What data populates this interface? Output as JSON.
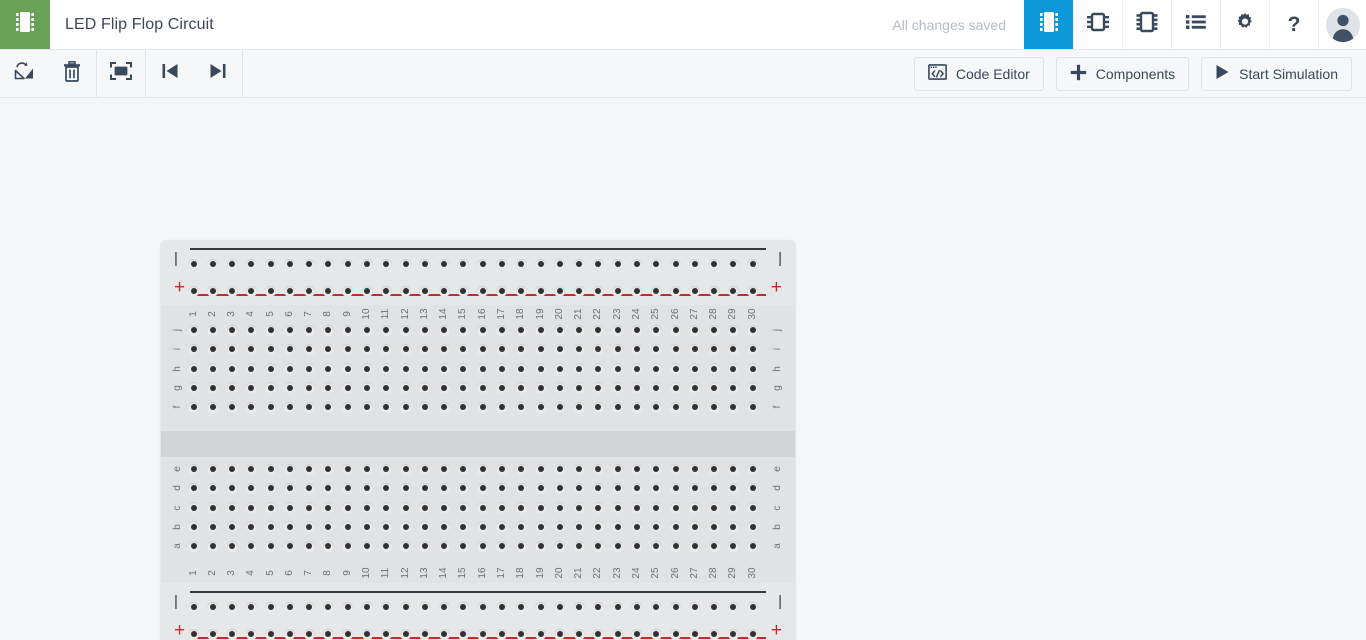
{
  "header": {
    "logo_icon": "chip-logo-icon",
    "title": "LED Flip Flop Circuit",
    "save_status": "All changes saved",
    "nav_items": [
      {
        "name": "view-breadboard",
        "icon": "chip-dip-icon",
        "active": true
      },
      {
        "name": "view-schematic",
        "icon": "ic-horizontal-icon",
        "active": false
      },
      {
        "name": "view-pcb",
        "icon": "ic-vertical-icon",
        "active": false
      },
      {
        "name": "view-list",
        "icon": "list-icon",
        "active": false
      },
      {
        "name": "settings",
        "icon": "gear-icon",
        "active": false
      },
      {
        "name": "help",
        "icon": "question-mark-icon",
        "active": false
      }
    ],
    "avatar_icon": "user-avatar-icon"
  },
  "toolbar": {
    "left_buttons": [
      {
        "name": "flip-button",
        "icon": "flip-icon"
      },
      {
        "name": "delete-button",
        "icon": "trash-icon"
      },
      {
        "name": "fit-to-screen-button",
        "icon": "fit-screen-icon"
      },
      {
        "name": "step-backward-button",
        "icon": "step-backward-icon"
      },
      {
        "name": "step-forward-button",
        "icon": "step-forward-icon"
      }
    ],
    "code_editor_label": "Code Editor",
    "components_label": "Components",
    "start_simulation_label": "Start Simulation"
  },
  "breadboard": {
    "columns": [
      "1",
      "2",
      "3",
      "4",
      "5",
      "6",
      "7",
      "8",
      "9",
      "10",
      "11",
      "12",
      "13",
      "14",
      "15",
      "16",
      "17",
      "18",
      "19",
      "20",
      "21",
      "22",
      "23",
      "24",
      "25",
      "26",
      "27",
      "28",
      "29",
      "30"
    ],
    "upper_rows": [
      "j",
      "i",
      "h",
      "g",
      "f"
    ],
    "lower_rows": [
      "e",
      "d",
      "c",
      "b",
      "a"
    ],
    "rail_negative_symbol": "|",
    "rail_positive_symbol": "+",
    "rail_negative_color": "#3a3a3a",
    "rail_positive_color": "#c22b2b",
    "rail_hole_rows": 2,
    "rail_hole_columns": 30
  },
  "colors": {
    "brand_green": "#6aa255",
    "accent_blue": "#0c98d9",
    "text_dark": "#3c4858",
    "canvas_bg": "#f4f6f8"
  }
}
